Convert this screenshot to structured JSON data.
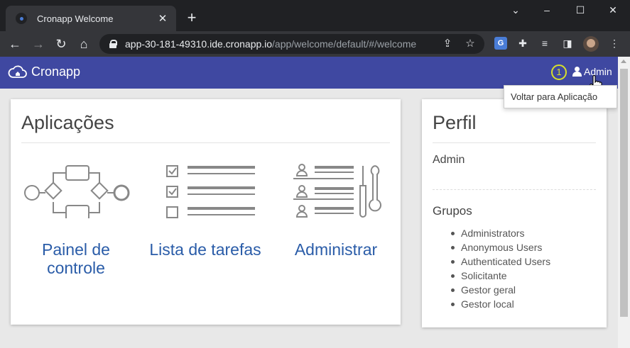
{
  "browser": {
    "tab_title": "Cronapp Welcome",
    "tab_close": "✕",
    "new_tab": "+",
    "url_host": "app-30-181-49310.ide.cronapp.io",
    "url_path": "/app/welcome/default/#/welcome"
  },
  "navbar": {
    "brand": "Cronapp",
    "step_number": "1",
    "user_label": "Admin",
    "accent_color": "#3f48a1"
  },
  "dropdown": {
    "items": [
      "Voltar para Aplicação"
    ]
  },
  "applications": {
    "title": "Aplicações",
    "apps": [
      {
        "label": "Painel de controle",
        "icon": "workflow-icon"
      },
      {
        "label": "Lista de tarefas",
        "icon": "checklist-icon"
      },
      {
        "label": "Administrar",
        "icon": "admin-tools-icon"
      }
    ]
  },
  "profile": {
    "title": "Perfil",
    "name": "Admin",
    "groups_title": "Grupos",
    "groups": [
      "Administrators",
      "Anonymous Users",
      "Authenticated Users",
      "Solicitante",
      "Gestor geral",
      "Gestor local"
    ]
  }
}
